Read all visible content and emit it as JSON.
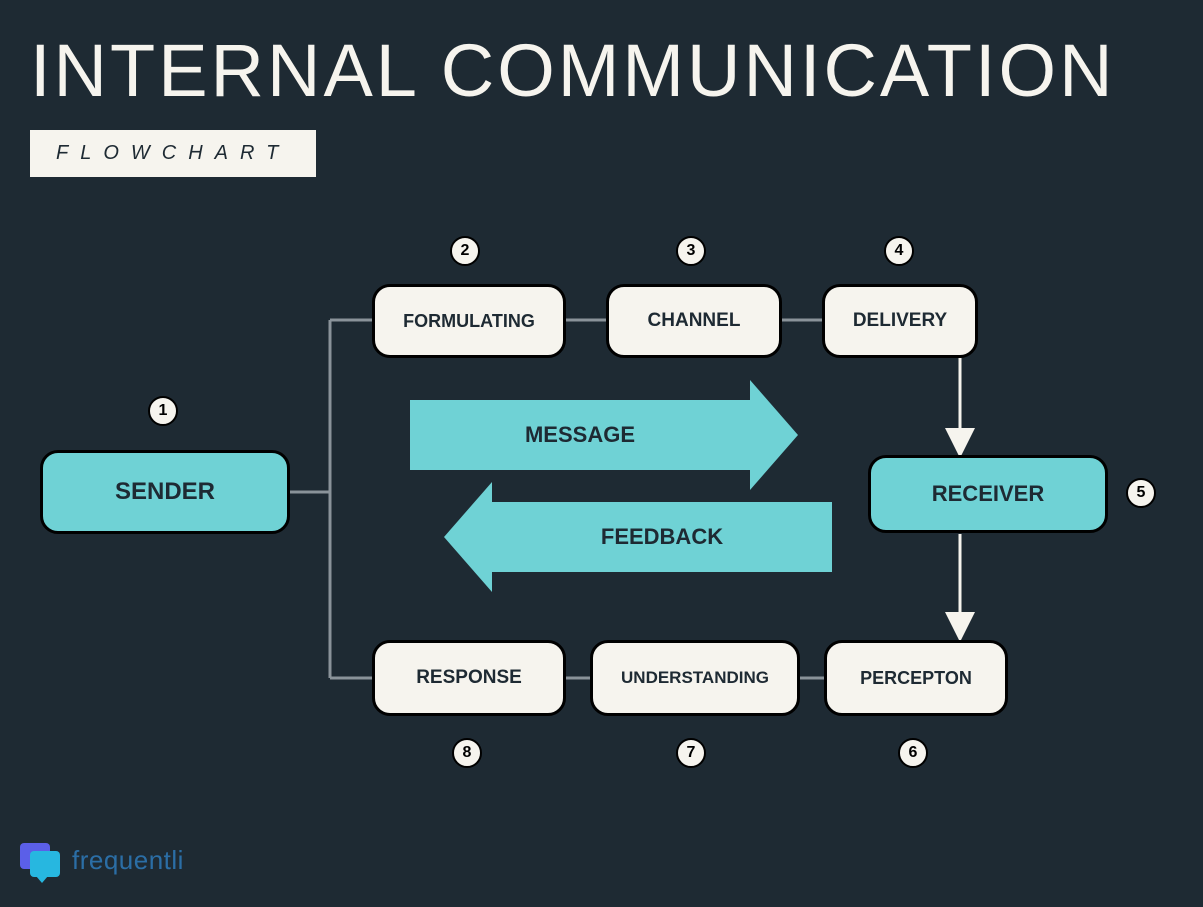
{
  "colors": {
    "bg": "#1e2a33",
    "paper": "#f6f4ee",
    "cyan": "#6fd2d5",
    "ink": "#000000"
  },
  "title": "INTERNAL COMMUNICATION",
  "subtitle": "FLOWCHART",
  "nodes": {
    "sender": {
      "num": "1",
      "label": "SENDER"
    },
    "formulating": {
      "num": "2",
      "label": "FORMULATING"
    },
    "channel": {
      "num": "3",
      "label": "CHANNEL"
    },
    "delivery": {
      "num": "4",
      "label": "DELIVERY"
    },
    "receiver": {
      "num": "5",
      "label": "RECEIVER"
    },
    "perception": {
      "num": "6",
      "label": "PERCEPTON"
    },
    "understanding": {
      "num": "7",
      "label": "UNDERSTANDING"
    },
    "response": {
      "num": "8",
      "label": "RESPONSE"
    }
  },
  "arrows": {
    "message": "MESSAGE",
    "feedback": "FEEDBACK"
  },
  "brand": "frequentli"
}
